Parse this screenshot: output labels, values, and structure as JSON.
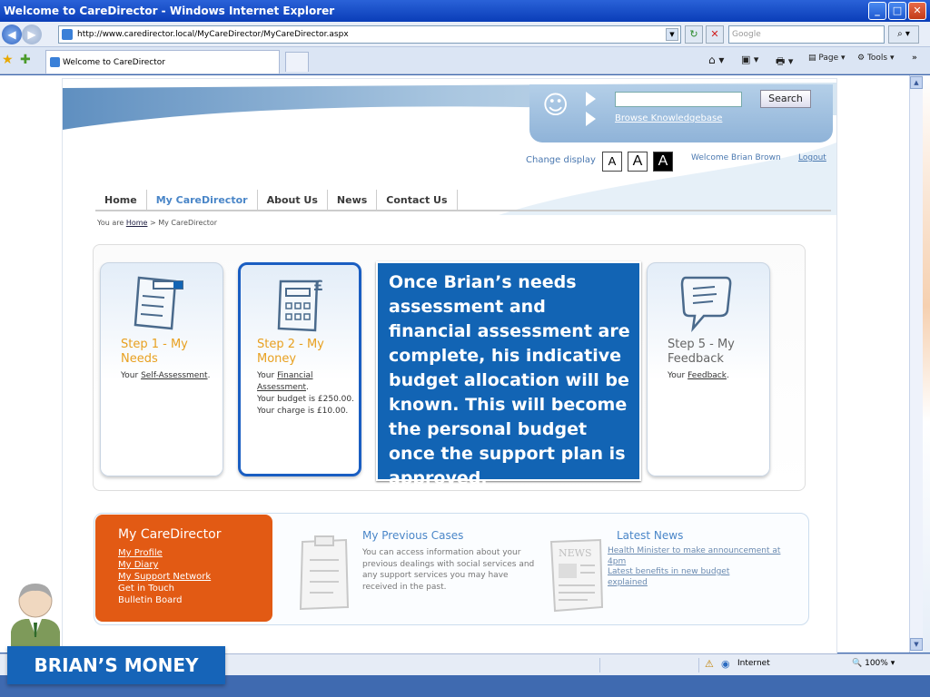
{
  "browser": {
    "window_title": "Welcome to CareDirector - Windows Internet Explorer",
    "url": "http://www.caredirector.local/MyCareDirector/MyCareDirector.aspx",
    "search_placeholder": "Google",
    "tab_title": "Welcome to CareDirector",
    "cmd_page": "Page",
    "cmd_tools": "Tools",
    "status_zone": "Internet",
    "zoom": "100%"
  },
  "site": {
    "search_button": "Search",
    "knowledgebase_link": "Browse Knowledgebase",
    "change_display": "Change display",
    "text_size_options": [
      "A",
      "A",
      "A"
    ],
    "welcome": "Welcome Brian Brown",
    "logout": "Logout",
    "nav": [
      "Home",
      "My CareDirector",
      "About Us",
      "News",
      "Contact Us"
    ],
    "breadcrumb_prefix": "You are",
    "breadcrumb_home": "Home",
    "breadcrumb_current": "> My CareDirector"
  },
  "steps": [
    {
      "title": "Step 1 - My Needs",
      "text_prefix": "Your",
      "link": "Self-Assessment",
      "text_suffix": "."
    },
    {
      "title": "Step 2 - My Money",
      "text_prefix": "Your",
      "link": "Financial Assessment",
      "text_suffix": ".",
      "budget": "Your budget is £250.00.",
      "charge": "Your charge is £10.00."
    },
    {
      "title": "Step 5 - My Feedback",
      "text_prefix": "Your",
      "link": "Feedback",
      "text_suffix": "."
    }
  ],
  "overlay_text": "Once Brian’s needs assessment and financial assessment are complete, his indicative budget allocation will be known. This will become the personal budget once the support plan is approved.",
  "my_caredirector": {
    "heading": "My CareDirector",
    "links": [
      "My Profile",
      "My Diary",
      "My Support Network"
    ],
    "items": [
      "Get in Touch",
      "Bulletin Board"
    ]
  },
  "previous_cases": {
    "heading": "My Previous Cases",
    "text": "You can access information about your previous dealings with social services and any support services you may have received in the past."
  },
  "latest_news": {
    "heading": "Latest News",
    "icon_label": "NEWS",
    "items": [
      "Health Minister to make announcement at 4pm",
      "Latest benefits in new budget explained"
    ]
  },
  "slide_label": "BRIAN’S MONEY",
  "colors": {
    "accent_orange": "#e25a14",
    "accent_blue": "#1264b4",
    "step_title": "#e8a020"
  }
}
